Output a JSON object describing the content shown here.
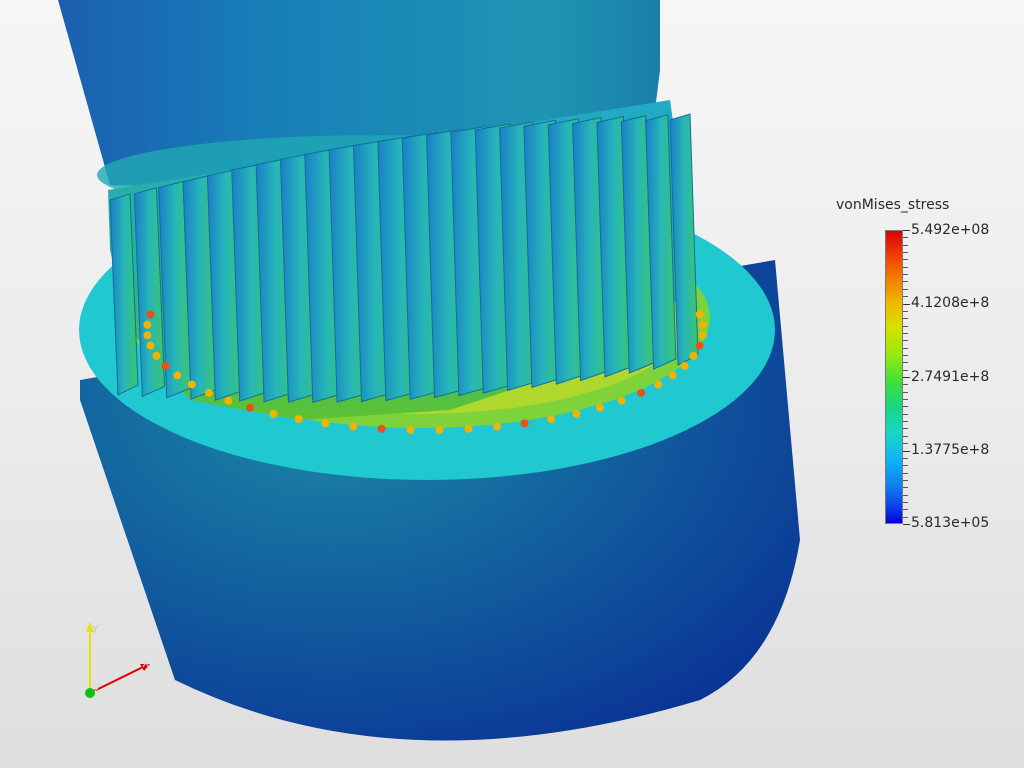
{
  "legend": {
    "title": "vonMises_stress",
    "labels": [
      "5.492e+08",
      "4.1208e+8",
      "2.7491e+8",
      "1.3775e+8",
      "5.813e+05"
    ]
  },
  "axes": {
    "x": "X",
    "y": "Y",
    "z": "Z"
  },
  "colors": {
    "high": "#d9000c",
    "mid": "#3ce03a",
    "low": "#0300d8",
    "background": "#ececec"
  }
}
